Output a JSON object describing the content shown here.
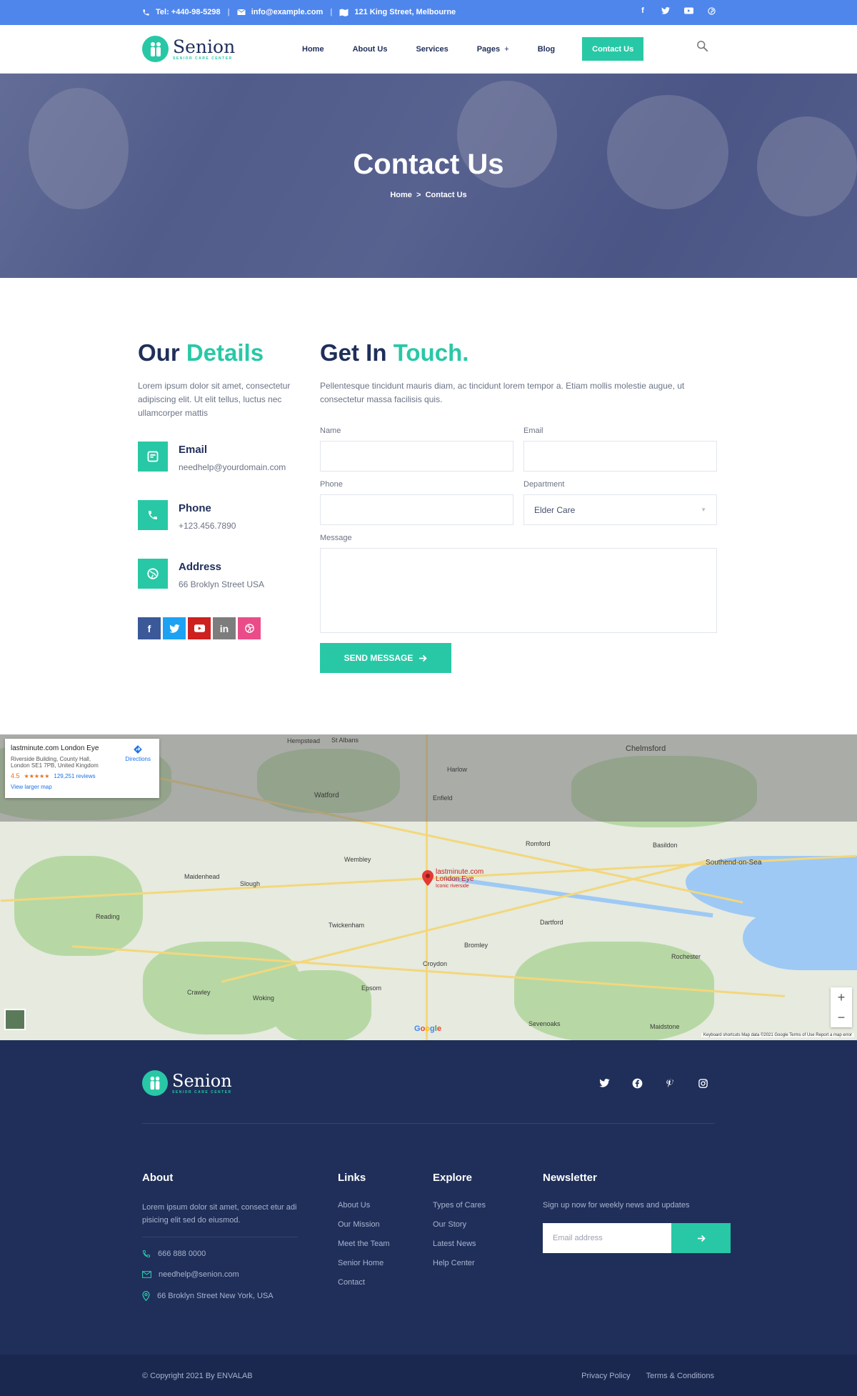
{
  "topbar": {
    "phone": "Tel: +440-98-5298",
    "email": "info@example.com",
    "address": "121 King Street, Melbourne",
    "social_icons": [
      "facebook-icon",
      "twitter-icon",
      "youtube-icon",
      "pinterest-icon"
    ]
  },
  "header": {
    "logo_name": "Senion",
    "logo_tagline": "SENIOR CARE CENTER",
    "nav": [
      "Home",
      "About Us",
      "Services",
      "Pages",
      "Blog",
      "Contact Us"
    ],
    "pages_caret": "+"
  },
  "hero": {
    "title": "Contact Us",
    "breadcrumb_home": "Home",
    "breadcrumb_sep": ">",
    "breadcrumb_current": "Contact Us"
  },
  "details": {
    "title_a": "Our",
    "title_b": "Details",
    "lead": "Lorem ipsum dolor sit amet, consectetur adipiscing elit. Ut elit tellus, luctus nec ullamcorper mattis",
    "items": [
      {
        "title": "Email",
        "value": "needhelp@yourdomain.com"
      },
      {
        "title": "Phone",
        "value": "+123.456.7890"
      },
      {
        "title": "Address",
        "value": "66 Broklyn Street USA"
      }
    ],
    "social_colors": [
      "#3b5998",
      "#1da1f2",
      "#cd201f",
      "#7d7d7d",
      "#ea4c89"
    ]
  },
  "form": {
    "title_a": "Get In",
    "title_b": "Touch.",
    "lead": "Pellentesque tincidunt mauris diam, ac tincidunt lorem tempor a. Etiam mollis molestie augue, ut consectetur massa facilisis quis.",
    "name_label": "Name",
    "email_label": "Email",
    "phone_label": "Phone",
    "department_label": "Department",
    "department_value": "Elder Care",
    "message_label": "Message",
    "send_label": "SEND MESSAGE"
  },
  "map": {
    "card_title": "lastminute.com London Eye",
    "card_address": "Riverside Building, County Hall, London SE1 7PB, United Kingdom",
    "card_rating": "4.5",
    "card_stars": "★★★★★",
    "card_reviews": "129,251 reviews",
    "card_directions": "Directions",
    "card_larger": "View larger map",
    "pin_label_1": "lastminute.com",
    "pin_label_2": "London Eye",
    "pin_label_3": "Iconic riverside",
    "places": [
      "St Albans",
      "Hempstead",
      "Chelmsford",
      "Harlow",
      "Watford",
      "Enfield",
      "Romford",
      "Basildon",
      "Southend-on-Sea",
      "Slough",
      "Wembley",
      "Reading",
      "Maidenhead",
      "Twickenham",
      "Dartford",
      "Bromley",
      "Croydon",
      "Epsom",
      "Woking",
      "Rochester",
      "Maidstone",
      "Sevenoaks",
      "Crawley"
    ],
    "attribution": "Keyboard shortcuts   Map data ©2021 Google   Terms of Use   Report a map error",
    "zoom_in": "+",
    "zoom_out": "−"
  },
  "footer": {
    "logo_name": "Senion",
    "logo_tagline": "SENIOR CARE CENTER",
    "social_icons": [
      "twitter-icon",
      "facebook-icon",
      "pinterest-icon",
      "instagram-icon"
    ],
    "about_title": "About",
    "about_text": "Lorem ipsum dolor sit amet, consect etur adi pisicing elit sed do eiusmod.",
    "contacts": [
      "666 888 0000",
      "needhelp@senion.com",
      "66 Broklyn Street New York, USA"
    ],
    "links_title": "Links",
    "links": [
      "About Us",
      "Our Mission",
      "Meet the Team",
      "Senior Home",
      "Contact"
    ],
    "explore_title": "Explore",
    "explore": [
      "Types of Cares",
      "Our Story",
      "Latest News",
      "Help Center"
    ],
    "newsletter_title": "Newsletter",
    "newsletter_text": "Sign up now for weekly news and updates",
    "newsletter_placeholder": "Email address"
  },
  "bottom": {
    "copyright": "© Copyright 2021 By ENVALAB",
    "privacy": "Privacy Policy",
    "terms": "Terms & Conditions"
  },
  "colors": {
    "accent": "#28c8a6",
    "primary": "#1f2f5a",
    "topbar": "#4f86ec"
  }
}
